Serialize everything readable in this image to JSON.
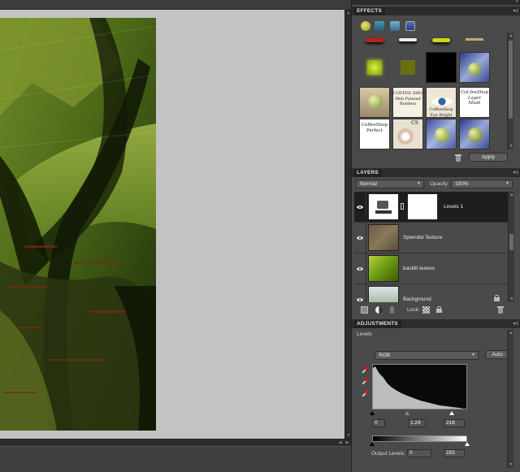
{
  "effects": {
    "tab_label": "EFFECTS",
    "apply_label": "Apply",
    "thumbnails": [
      {
        "name": "effect-coffeeshop-web-painted-borders",
        "text": "COFFEE SHOP\nWeb Painted\nBorders"
      },
      {
        "name": "effect-coffeeshop-eye-bright",
        "text": "CoffeeShop\nEye Bright"
      },
      {
        "name": "effect-coffeeshop-layer-mask",
        "text": "Cof feeShop\nLayer\nMask"
      },
      {
        "name": "effect-coffeeshop-perfect",
        "text": "CoffeeShop\nPerfect"
      },
      {
        "name": "effect-cs",
        "text": "CS"
      }
    ]
  },
  "layers": {
    "tab_label": "LAYERS",
    "blend_mode": "Normal",
    "opacity_label": "Opacity:",
    "opacity_value": "100%",
    "lock_label": "Lock:",
    "items": [
      {
        "name": "Levels 1"
      },
      {
        "name": "Splendid Texture"
      },
      {
        "name": "backlit leaves"
      },
      {
        "name": "Background"
      }
    ]
  },
  "adjustments": {
    "tab_label": "ADJUSTMENTS",
    "subtitle": "Levels",
    "channel": "RGB",
    "auto_label": "Auto",
    "input_black": "0",
    "input_gamma": "1.24",
    "input_white": "218",
    "output_label": "Output Levels:",
    "output_black": "0",
    "output_white": "255"
  },
  "colors": {
    "panel_bg": "#4a4a4a",
    "tab_bg": "#2c2c2c",
    "workspace": "#c3c3c3",
    "selected_layer": "#1e1e1e"
  }
}
